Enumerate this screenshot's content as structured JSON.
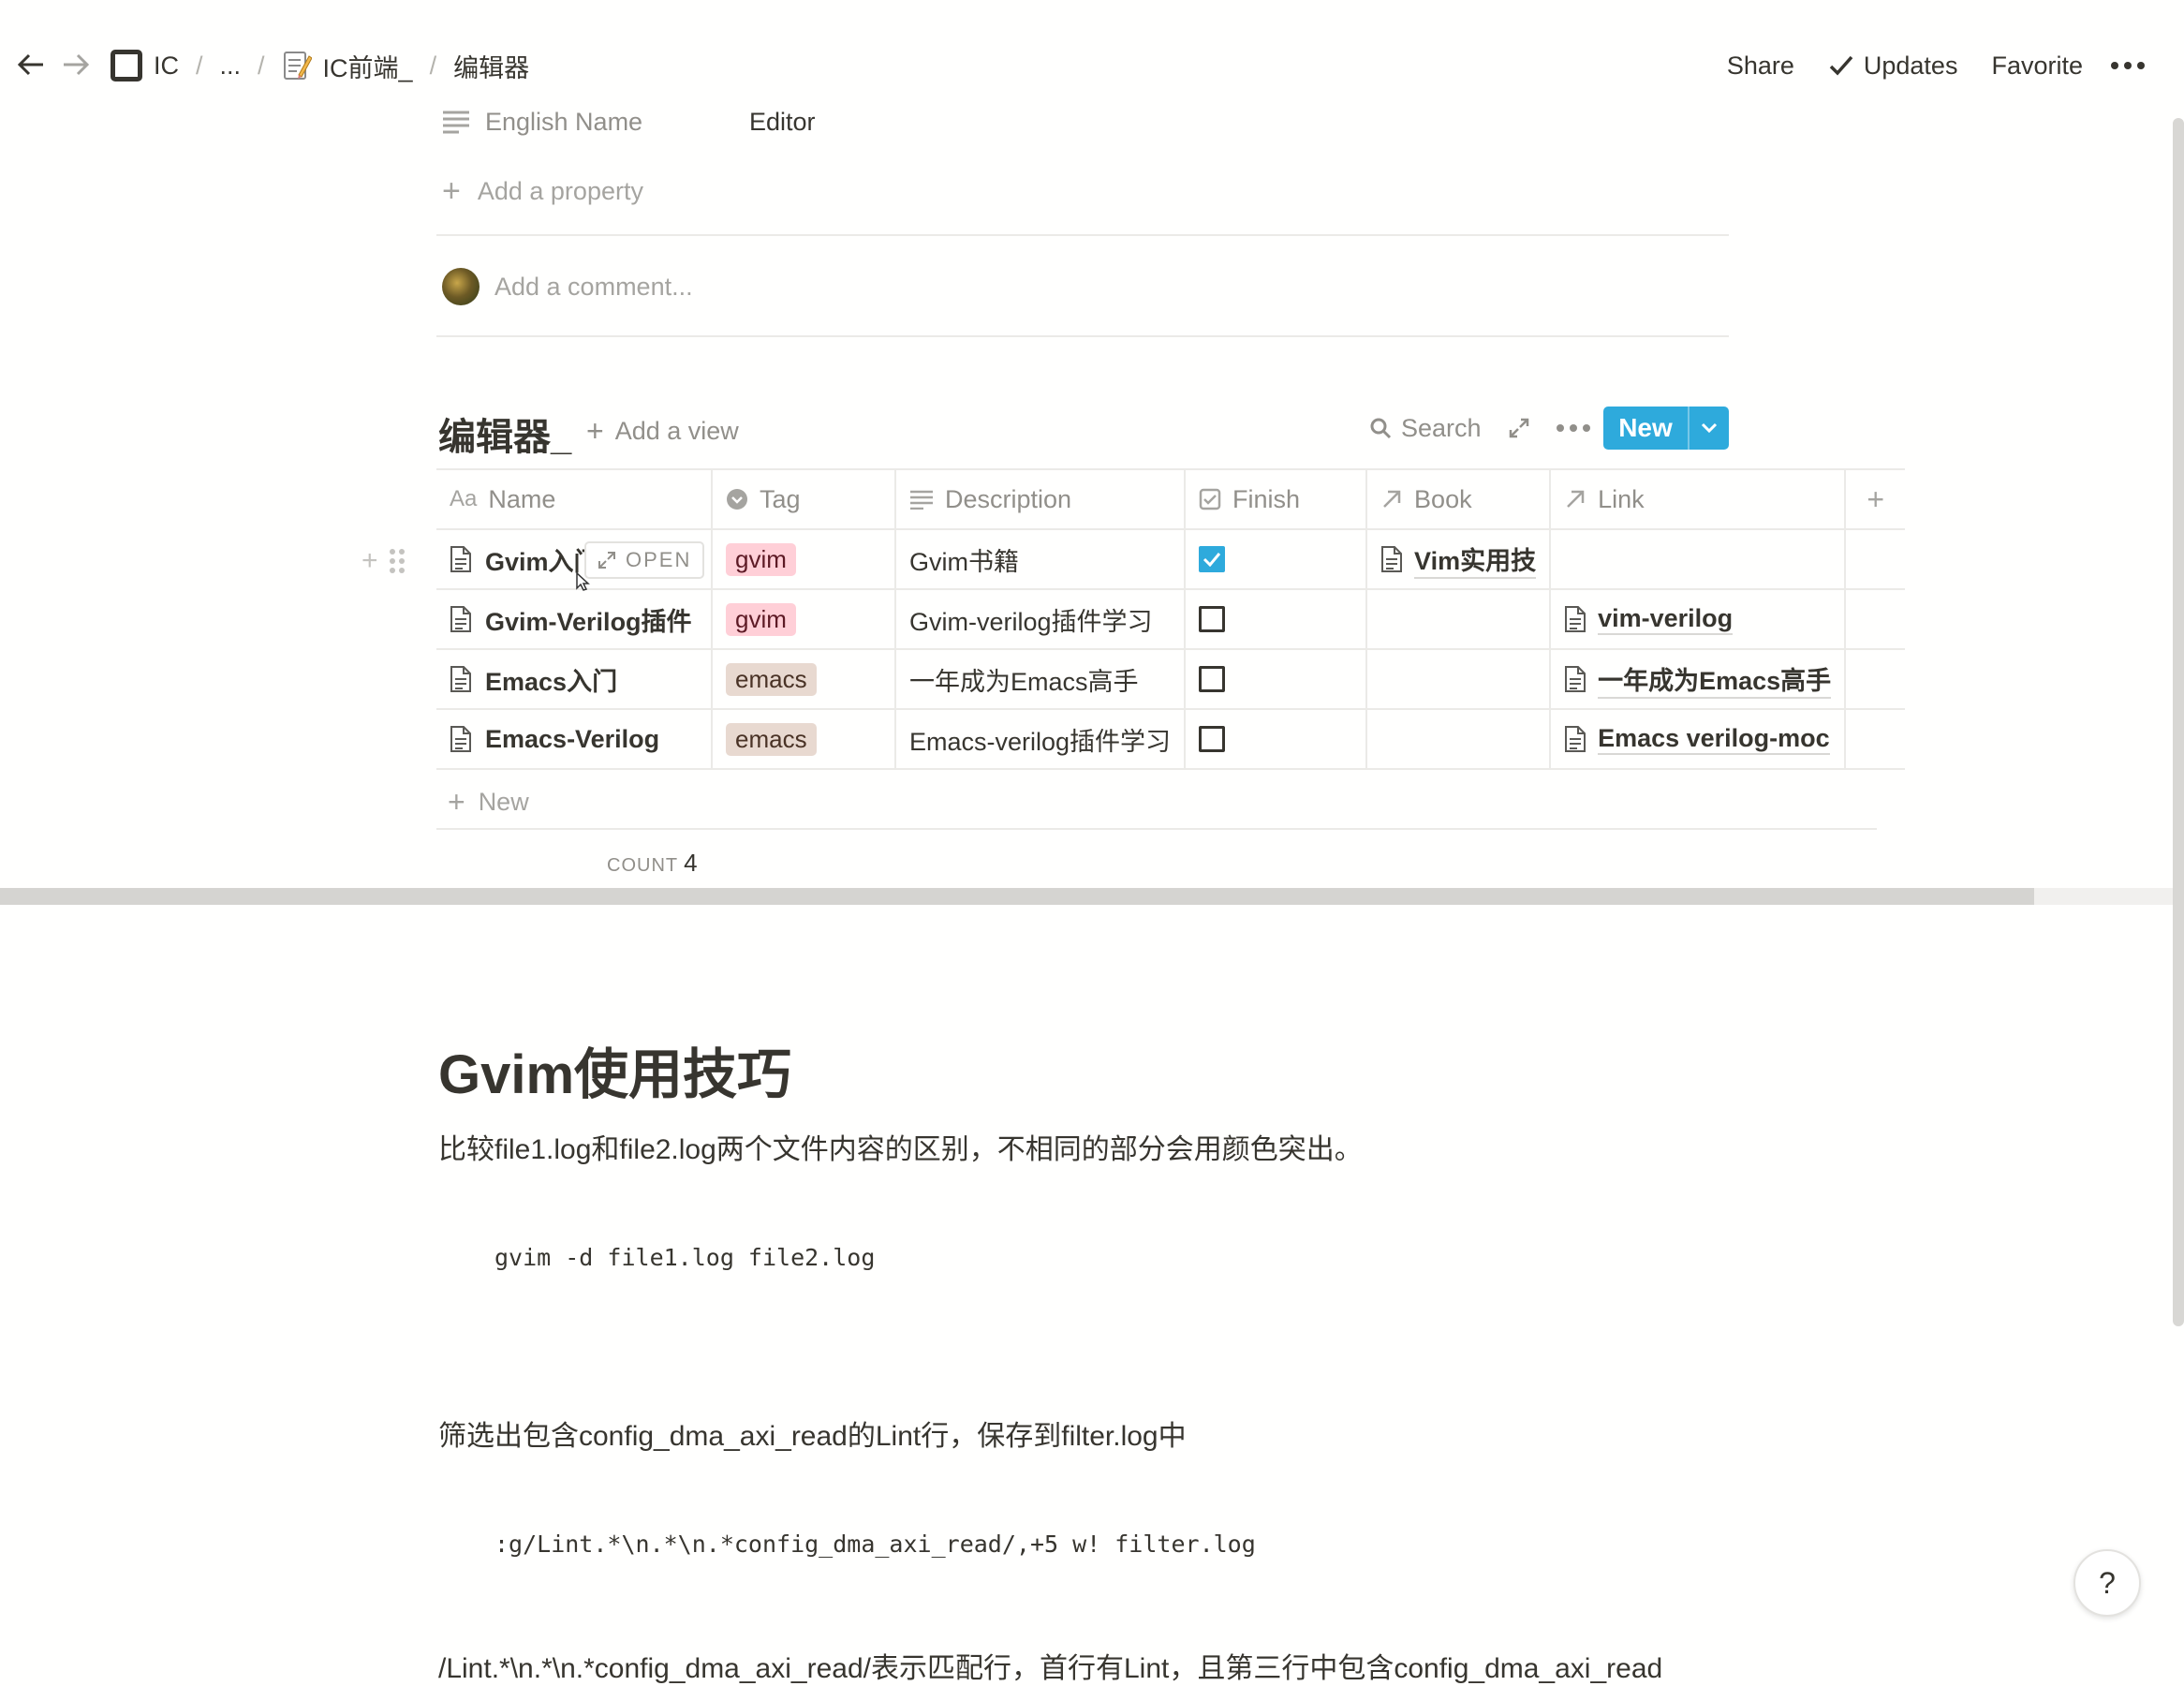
{
  "breadcrumb": {
    "workspace": "IC",
    "ellipsis": "...",
    "parent": "IC前端_",
    "current": "编辑器",
    "separator": "/"
  },
  "topbar": {
    "share": "Share",
    "updates": "Updates",
    "favorite": "Favorite"
  },
  "properties": {
    "english_name_label": "English Name",
    "english_name_value": "Editor",
    "add_property": "Add a property",
    "comment_placeholder": "Add a comment..."
  },
  "database": {
    "title": "编辑器_",
    "add_view": "Add a view",
    "search": "Search",
    "new_button": "New",
    "columns": {
      "name": "Name",
      "tag": "Tag",
      "description": "Description",
      "finish": "Finish",
      "book": "Book",
      "link": "Link"
    },
    "open_button": "OPEN",
    "rows": [
      {
        "name": "Gvim入门",
        "tag": "gvim",
        "description": "Gvim书籍",
        "finish": true,
        "book": "Vim实用技",
        "link": ""
      },
      {
        "name": "Gvim-Verilog插件",
        "tag": "gvim",
        "description": "Gvim-verilog插件学习",
        "finish": false,
        "book": "",
        "link": "vim-verilog"
      },
      {
        "name": "Emacs入门",
        "tag": "emacs",
        "description": "一年成为Emacs高手",
        "finish": false,
        "book": "",
        "link": "一年成为Emacs高手"
      },
      {
        "name": "Emacs-Verilog",
        "tag": "emacs",
        "description": "Emacs-verilog插件学习",
        "finish": false,
        "book": "",
        "link": "Emacs verilog-moc"
      }
    ],
    "new_row": "New",
    "count_label": "COUNT",
    "count_value": "4",
    "tag_colors": {
      "gvim": "#ffcfd7",
      "emacs": "#e8d9d0"
    },
    "accent": "#2eaadc"
  },
  "content": {
    "heading": "Gvim使用技巧",
    "para1": "比较file1.log和file2.log两个文件内容的区别，不相同的部分会用颜色突出。",
    "code1": "gvim -d file1.log file2.log",
    "para2": "筛选出包含config_dma_axi_read的Lint行，保存到filter.log中",
    "code2": ":g/Lint.*\\n.*\\n.*config_dma_axi_read/,+5 w! filter.log",
    "para3": "/Lint.*\\n.*\\n.*config_dma_axi_read/表示匹配行，首行有Lint，且第三行中包含config_dma_axi_read"
  },
  "help": "?"
}
